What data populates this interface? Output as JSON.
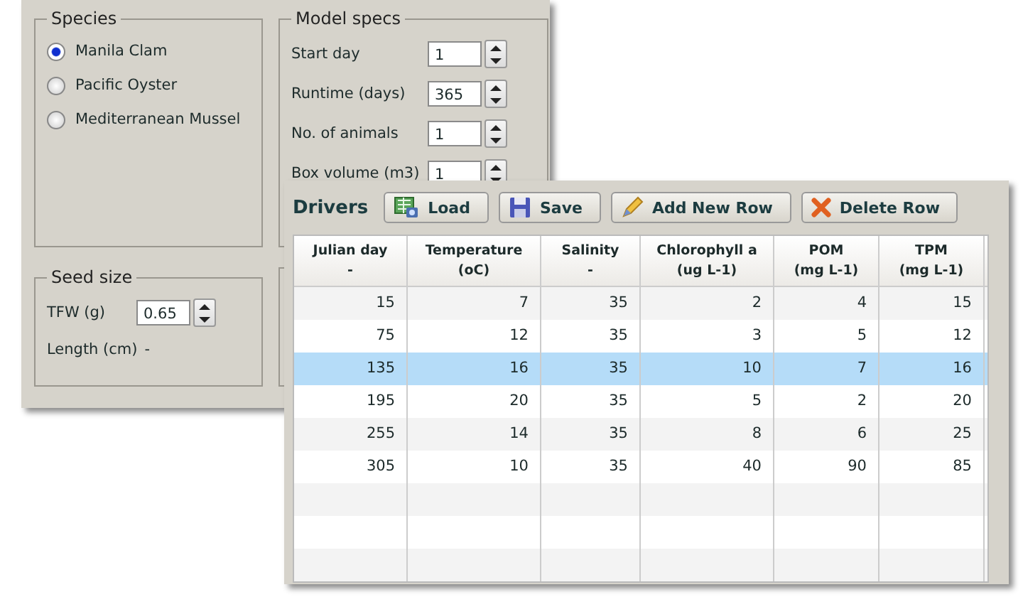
{
  "species": {
    "title": "Species",
    "options": [
      {
        "label": "Manila Clam",
        "selected": true
      },
      {
        "label": "Pacific Oyster",
        "selected": false
      },
      {
        "label": "Mediterranean Mussel",
        "selected": false
      }
    ]
  },
  "model_specs": {
    "title": "Model specs",
    "fields": [
      {
        "label": "Start day",
        "value": "1"
      },
      {
        "label": "Runtime (days)",
        "value": "365"
      },
      {
        "label": "No. of animals",
        "value": "1"
      },
      {
        "label": "Box volume (m3)",
        "value": "1"
      }
    ]
  },
  "seed_size": {
    "title": "Seed size",
    "tfw_label": "TFW (g)",
    "tfw_value": "0.65",
    "length_label": "Length (cm)",
    "length_value": "-"
  },
  "drivers": {
    "title": "Drivers",
    "buttons": [
      {
        "label": "Load",
        "kind": "load"
      },
      {
        "label": "Save",
        "kind": "save"
      },
      {
        "label": "Add New Row",
        "kind": "add"
      },
      {
        "label": "Delete Row",
        "kind": "delete"
      }
    ],
    "columns": [
      {
        "name": "Julian day",
        "unit": "-"
      },
      {
        "name": "Temperature",
        "unit": "(oC)"
      },
      {
        "name": "Salinity",
        "unit": "-"
      },
      {
        "name": "Chlorophyll a",
        "unit": "(ug L-1)"
      },
      {
        "name": "POM",
        "unit": "(mg L-1)"
      },
      {
        "name": "TPM",
        "unit": "(mg L-1)"
      }
    ],
    "rows": [
      {
        "cells": [
          "15",
          "7",
          "35",
          "2",
          "4",
          "15"
        ],
        "selected": false
      },
      {
        "cells": [
          "75",
          "12",
          "35",
          "3",
          "5",
          "12"
        ],
        "selected": false
      },
      {
        "cells": [
          "135",
          "16",
          "35",
          "10",
          "7",
          "16"
        ],
        "selected": true
      },
      {
        "cells": [
          "195",
          "20",
          "35",
          "5",
          "2",
          "20"
        ],
        "selected": false
      },
      {
        "cells": [
          "255",
          "14",
          "35",
          "8",
          "6",
          "25"
        ],
        "selected": false
      },
      {
        "cells": [
          "305",
          "10",
          "35",
          "40",
          "90",
          "85"
        ],
        "selected": false
      }
    ]
  }
}
